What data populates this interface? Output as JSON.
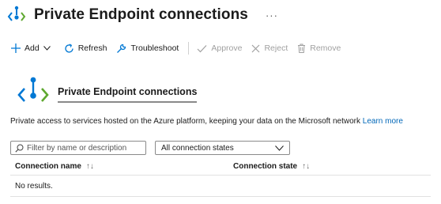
{
  "header": {
    "title": "Private Endpoint connections",
    "more": "···"
  },
  "toolbar": {
    "add": "Add",
    "refresh": "Refresh",
    "troubleshoot": "Troubleshoot",
    "approve": "Approve",
    "reject": "Reject",
    "remove": "Remove"
  },
  "hero": {
    "title": "Private Endpoint connections"
  },
  "description": {
    "text": "Private access to services hosted on the Azure platform, keeping your data on the Microsoft network",
    "link": "Learn more"
  },
  "filter": {
    "placeholder": "Filter by name or description",
    "value": ""
  },
  "state_select": {
    "selected": "All connection states"
  },
  "table": {
    "columns": [
      "Connection name",
      "Connection state"
    ],
    "rows": [],
    "empty_text": "No results."
  },
  "colors": {
    "accent": "#0067b8",
    "icon_blue": "#0078d4",
    "icon_green": "#5ea82f",
    "disabled": "#a0a0a0"
  },
  "icons": [
    "private-endpoint-icon",
    "plus-icon",
    "chevron-down-icon",
    "refresh-icon",
    "wrench-icon",
    "checkmark-icon",
    "close-icon",
    "trash-icon",
    "search-icon",
    "sort-icon"
  ]
}
